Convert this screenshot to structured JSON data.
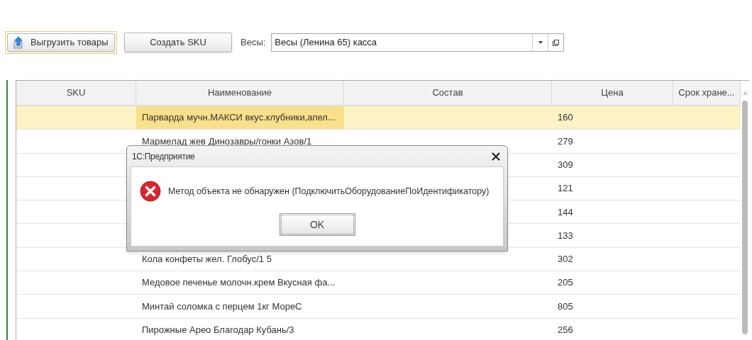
{
  "toolbar": {
    "export_button": "Выгрузить товары",
    "create_button": "Создать SKU",
    "scales_label": "Весы:",
    "scales_value": "Весы (Ленина 65) касса"
  },
  "table": {
    "columns": [
      "SKU",
      "Наименование",
      "Состав",
      "Цена",
      "Срок хране..."
    ],
    "rows": [
      {
        "name": "Парварда мучн.МАКСИ вкус.клубники,апел...",
        "price": "160",
        "selected": true
      },
      {
        "name": "Мармелад жев Динозавры/гонки Азов/1",
        "price": "279",
        "selected": false
      },
      {
        "price": "309",
        "selected": false
      },
      {
        "price": "121",
        "selected": false
      },
      {
        "price": "144",
        "selected": false
      },
      {
        "price": "133",
        "selected": false
      },
      {
        "name": "Кола конфеты жел. Глобус/1 5",
        "price": "302",
        "selected": false
      },
      {
        "name": "Медовое печенье молочн.крем Вкусная фа...",
        "price": "205",
        "selected": false
      },
      {
        "name": "Минтай соломка с перцем 1кг МореС",
        "price": "805",
        "selected": false
      },
      {
        "name": "Пирожные Арео Благодар Кубань/3",
        "price": "256",
        "selected": false
      }
    ]
  },
  "dialog": {
    "title": "1С:Предприятие",
    "kind": "error",
    "message": "Метод объекта не обнаружен (ПодключитьОборудованиеПоИдентификатору)",
    "button": "OK"
  }
}
